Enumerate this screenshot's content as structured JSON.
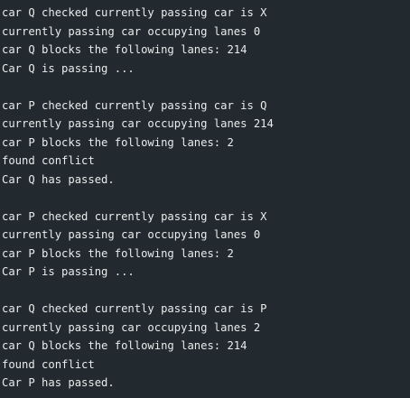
{
  "terminal": {
    "lines": [
      "car Q checked currently passing car is X",
      "currently passing car occupying lanes 0",
      "car Q blocks the following lanes: 214",
      "Car Q is passing ...",
      "",
      "car P checked currently passing car is Q",
      "currently passing car occupying lanes 214",
      "car P blocks the following lanes: 2",
      "found conflict",
      "Car Q has passed.",
      "",
      "car P checked currently passing car is X",
      "currently passing car occupying lanes 0",
      "car P blocks the following lanes: 2",
      "Car P is passing ...",
      "",
      "car Q checked currently passing car is P",
      "currently passing car occupying lanes 2",
      "car Q blocks the following lanes: 214",
      "found conflict",
      "Car P has passed."
    ]
  }
}
